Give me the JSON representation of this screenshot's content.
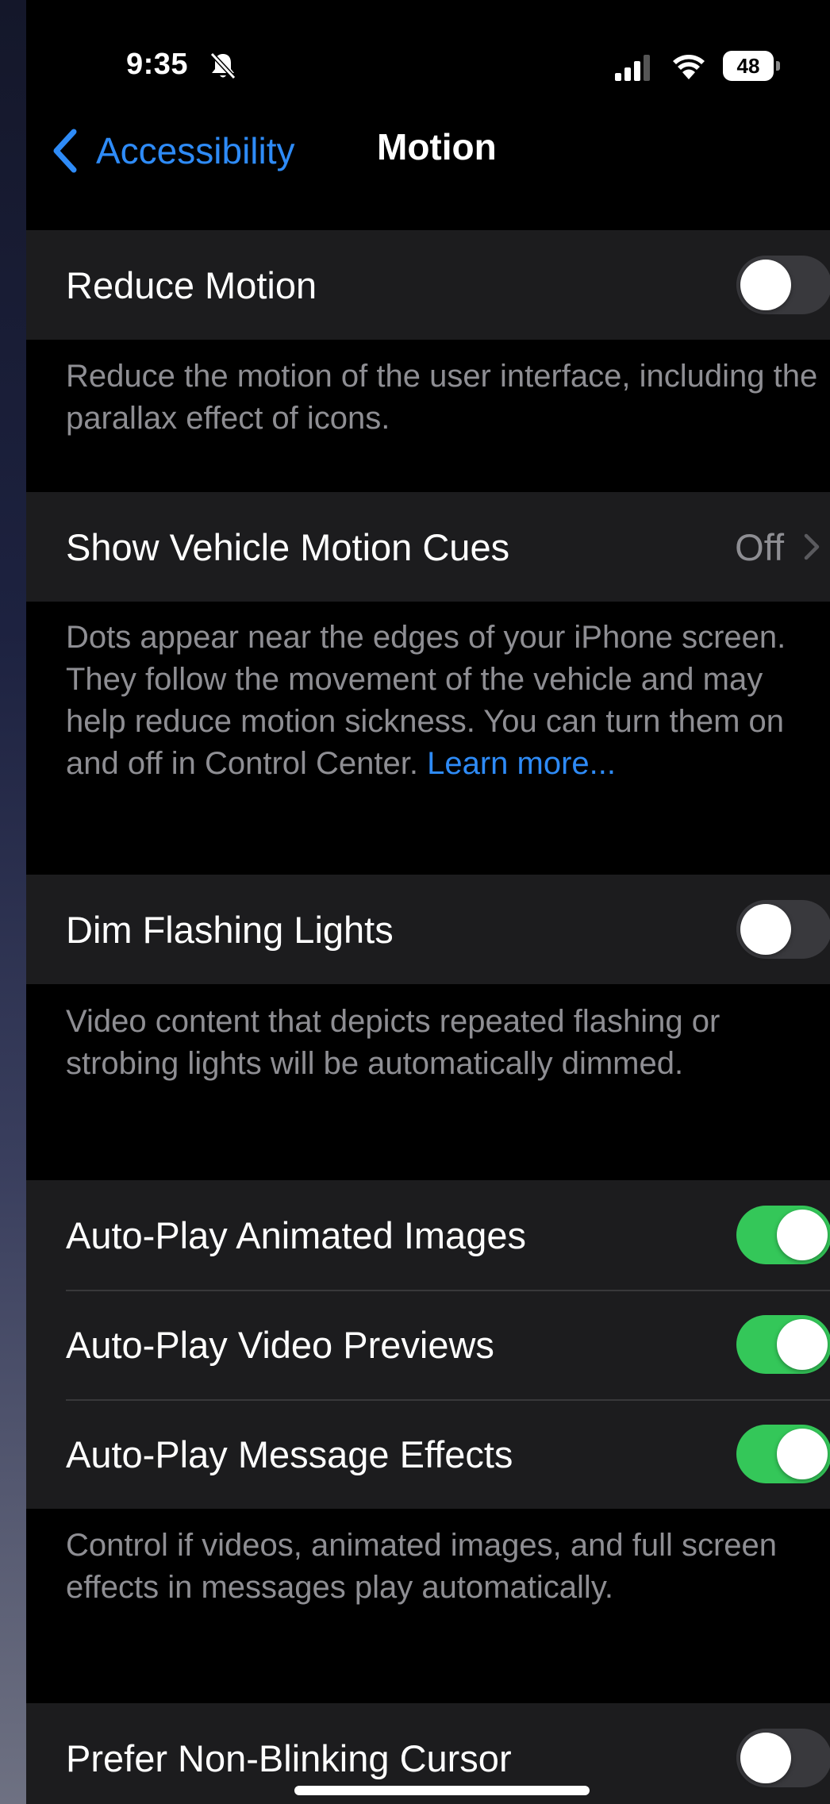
{
  "status_bar": {
    "time": "9:35",
    "battery": "48",
    "icons": [
      "bell-slash-icon",
      "cellular-signal-icon",
      "wifi-icon",
      "battery-icon"
    ]
  },
  "nav": {
    "back_label": "Accessibility",
    "title": "Motion"
  },
  "settings": {
    "reduce_motion": {
      "label": "Reduce Motion",
      "enabled": false,
      "footer": "Reduce the motion of the user interface, including the parallax effect of icons."
    },
    "vehicle_motion_cues": {
      "label": "Show Vehicle Motion Cues",
      "value": "Off",
      "footer": "Dots appear near the edges of your iPhone screen. They follow the movement of the vehicle and may help reduce motion sickness. You can turn them on and off in Control Center.",
      "footer_link": "Learn more..."
    },
    "dim_flashing_lights": {
      "label": "Dim Flashing Lights",
      "enabled": false,
      "footer": "Video content that depicts repeated flashing or strobing lights will be automatically dimmed."
    },
    "autoplay": {
      "animated_images": {
        "label": "Auto-Play Animated Images",
        "enabled": true
      },
      "video_previews": {
        "label": "Auto-Play Video Previews",
        "enabled": true
      },
      "message_effects": {
        "label": "Auto-Play Message Effects",
        "enabled": true
      },
      "footer": "Control if videos, animated images, and full screen effects in messages play automatically."
    },
    "non_blinking_cursor": {
      "label": "Prefer Non-Blinking Cursor",
      "enabled": false
    }
  },
  "colors": {
    "accent_blue": "#2e8bf7",
    "toggle_on": "#34c759",
    "toggle_off": "#39393d",
    "cell_background": "#1c1c1e",
    "footer_text": "#8e8e93"
  }
}
